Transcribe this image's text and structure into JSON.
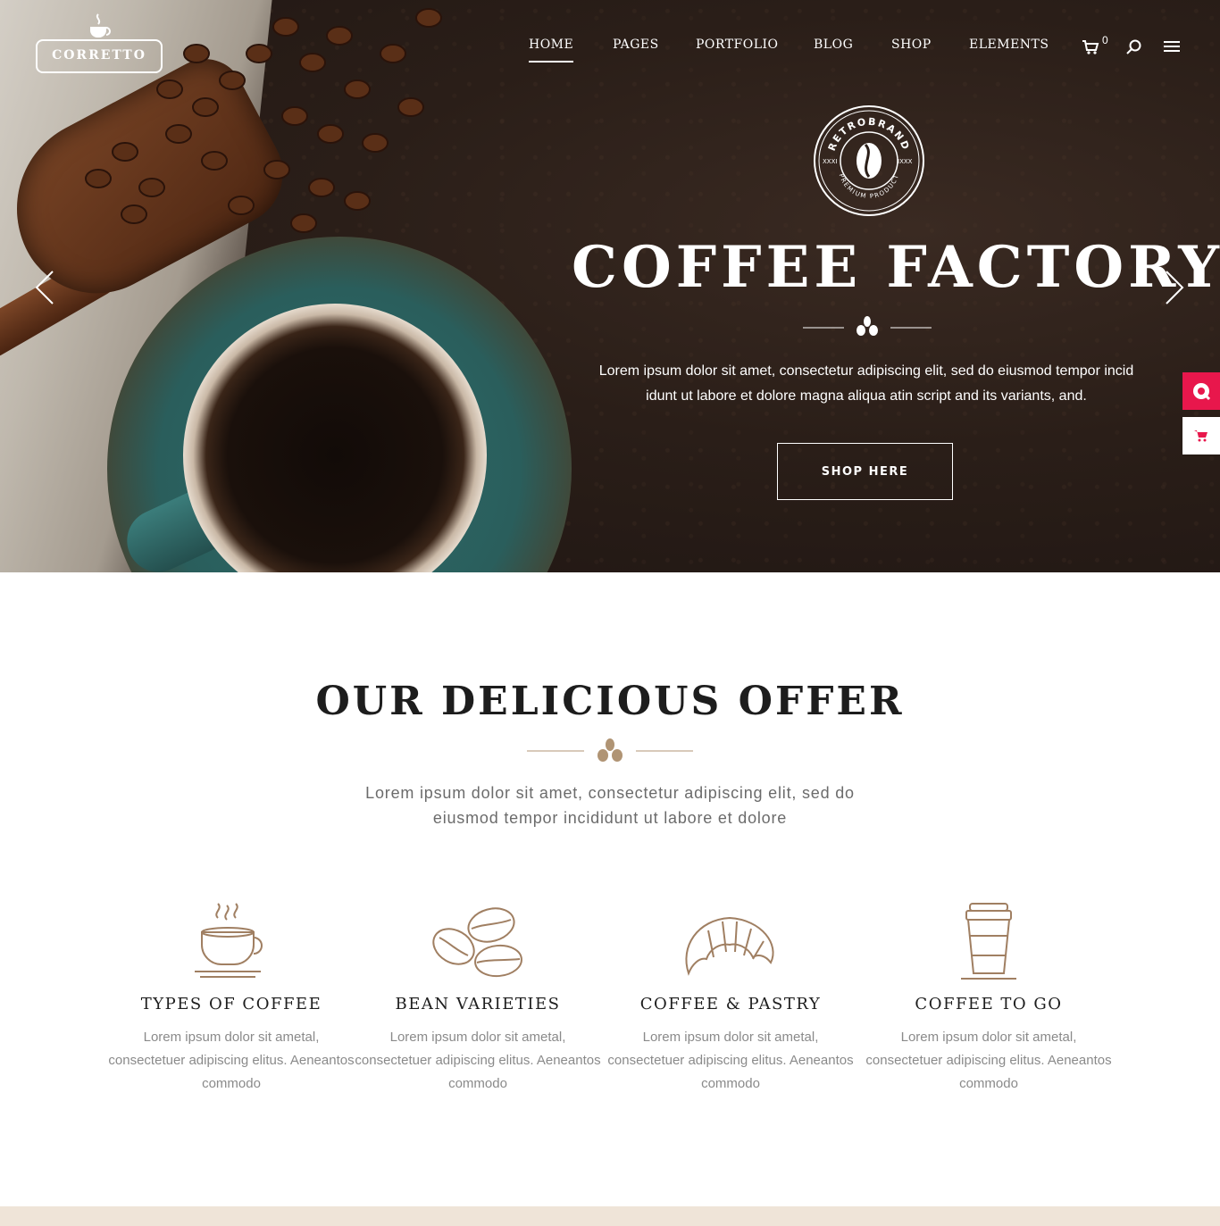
{
  "brand": {
    "logo_text": "CORRETTO"
  },
  "nav": {
    "items": [
      "HOME",
      "PAGES",
      "PORTFOLIO",
      "BLOG",
      "SHOP",
      "ELEMENTS"
    ],
    "cart_count": "0"
  },
  "hero": {
    "emblem": {
      "top_text": "RETROBRAND",
      "bottom_text": "PREMIUM PRODUCT",
      "left_text": "XXXI",
      "right_text": "IXXX"
    },
    "title": "COFFEE FACTORY",
    "text": "Lorem ipsum dolor sit amet, consectetur adipiscing elit, sed do eiusmod tempor incid idunt ut labore et dolore magna aliqua atin script and its variants, and.",
    "button_label": "SHOP HERE"
  },
  "offer": {
    "title": "OUR DELICIOUS OFFER",
    "text": "Lorem ipsum dolor sit amet, consectetur adipiscing elit, sed do eiusmod tempor incididunt ut labore et dolore",
    "features": [
      {
        "title": "TYPES OF COFFEE",
        "desc": "Lorem ipsum dolor sit ametal, consectetuer adipiscing elitus. Aeneantos commodo",
        "icon": "coffee-cup-icon"
      },
      {
        "title": "BEAN VARIETIES",
        "desc": "Lorem ipsum dolor sit ametal, consectetuer adipiscing elitus. Aeneantos commodo",
        "icon": "coffee-beans-icon"
      },
      {
        "title": "COFFEE & PASTRY",
        "desc": "Lorem ipsum dolor sit ametal, consectetuer adipiscing elitus. Aeneantos commodo",
        "icon": "croissant-icon"
      },
      {
        "title": "COFFEE TO GO",
        "desc": "Lorem ipsum dolor sit ametal, consectetuer adipiscing elitus. Aeneantos commodo",
        "icon": "takeaway-cup-icon"
      }
    ]
  },
  "colors": {
    "accent": "#b09474",
    "widget": "#e8174c",
    "hero_bg": "#2a1e18"
  }
}
